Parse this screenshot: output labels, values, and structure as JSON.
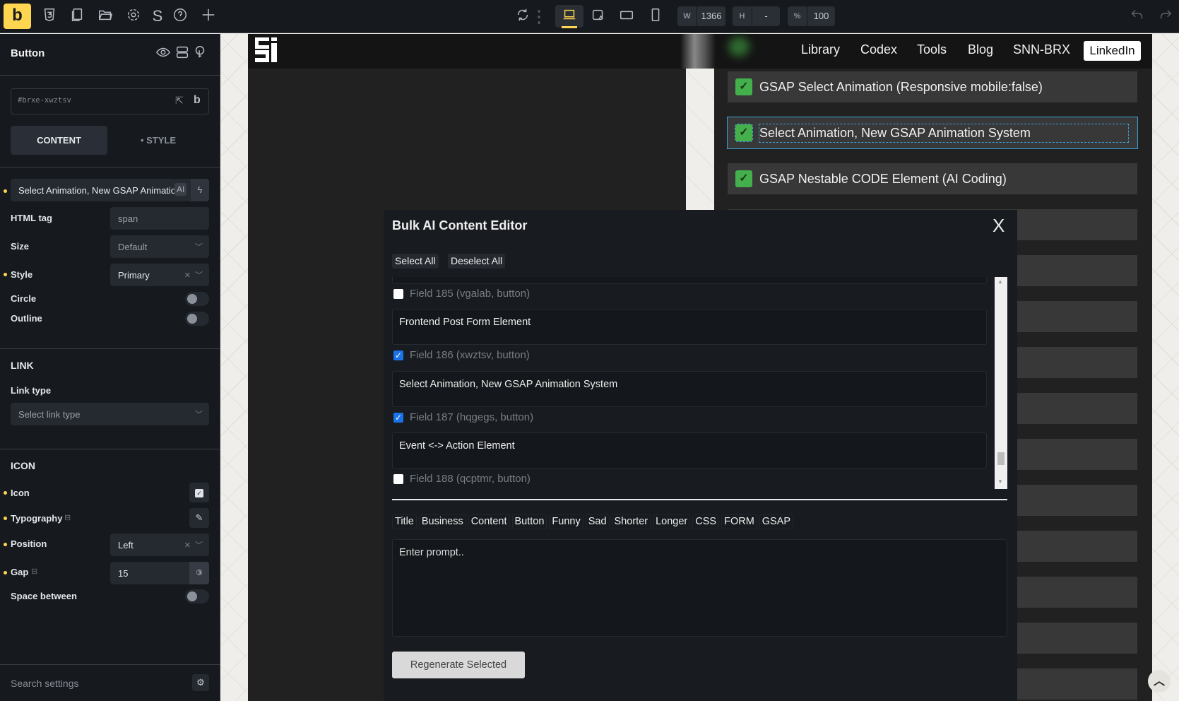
{
  "topbar": {
    "logo": "b",
    "width_label": "W",
    "width_value": "1366",
    "height_label": "H",
    "height_value": "-",
    "zoom_label": "%",
    "zoom_value": "100",
    "icons": [
      "css3-icon",
      "pages-icon",
      "folder-icon",
      "settings-gear-icon",
      "s-icon",
      "help-icon",
      "plus-icon",
      "refresh-icon",
      "more-dots-icon",
      "laptop-icon",
      "tablet-landscape-icon",
      "tablet-icon",
      "mobile-icon",
      "undo-icon",
      "redo-icon"
    ]
  },
  "sidebar": {
    "title": "Button",
    "element_id": "#brxe-xwztsv",
    "id_badge": "b",
    "tabs": [
      "CONTENT",
      "STYLE"
    ],
    "text_value": "Select Animation, New GSAP Animation System",
    "ai_badge": "AI",
    "html_tag_label": "HTML tag",
    "html_tag_value": "span",
    "size_label": "Size",
    "size_value": "Default",
    "style_label": "Style",
    "style_value": "Primary",
    "circle_label": "Circle",
    "outline_label": "Outline",
    "link_heading": "LINK",
    "link_type_label": "Link type",
    "link_type_placeholder": "Select link type",
    "icon_heading": "ICON",
    "icon_label": "Icon",
    "typography_label": "Typography",
    "position_label": "Position",
    "position_value": "Left",
    "gap_label": "Gap",
    "gap_value": "15",
    "space_between_label": "Space between",
    "search_placeholder": "Search settings"
  },
  "site": {
    "nav": [
      "Library",
      "Codex",
      "Tools",
      "Blog",
      "SNN-BRX"
    ],
    "linkedin": "LinkedIn",
    "items": [
      "GSAP Select Animation (Responsive mobile:false)",
      "Select Animation, New GSAP Animation System",
      "GSAP Nestable CODE Element (AI Coding)"
    ],
    "accent": "#44b04b"
  },
  "modal": {
    "title": "Bulk AI Content Editor",
    "close": "X",
    "select_all": "Select All",
    "deselect_all": "Deselect All",
    "fields": [
      {
        "label": "Field 185 (vgalab, button)",
        "checked": false,
        "value": "Frontend Post Form Element"
      },
      {
        "label": "Field 186 (xwztsv, button)",
        "checked": true,
        "value": "Select Animation, New GSAP Animation System"
      },
      {
        "label": "Field 187 (hqgegs, button)",
        "checked": true,
        "value": "Event <-> Action Element"
      },
      {
        "label": "Field 188 (qcptmr, button)",
        "checked": false
      }
    ],
    "chips": [
      "Title",
      "Business",
      "Content",
      "Button",
      "Funny",
      "Sad",
      "Shorter",
      "Longer",
      "CSS",
      "FORM",
      "GSAP"
    ],
    "prompt_placeholder": "Enter prompt..",
    "regenerate": "Regenerate Selected"
  }
}
